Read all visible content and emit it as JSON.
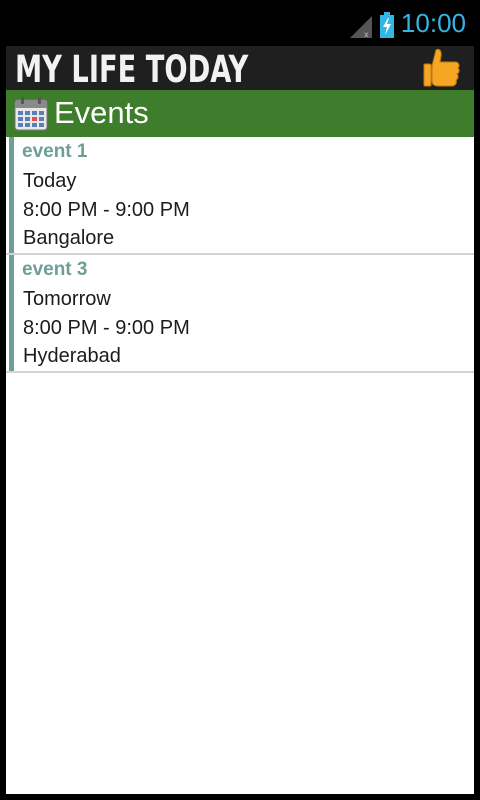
{
  "status_bar": {
    "time": "10:00",
    "icons": [
      "signal-icon",
      "battery-charging-icon"
    ],
    "time_color": "#33b5e5"
  },
  "app": {
    "title": "MY LIFE TODAY",
    "header_icon": "thumbs-up-icon"
  },
  "section": {
    "title": "Events",
    "icon": "calendar-icon",
    "color": "#3e7d2b"
  },
  "events": [
    {
      "title": "event 1",
      "day": "Today",
      "time": "8:00 PM - 9:00 PM",
      "location": "Bangalore"
    },
    {
      "title": "event 3",
      "day": "Tomorrow",
      "time": "8:00 PM - 9:00 PM",
      "location": "Hyderabad"
    }
  ]
}
